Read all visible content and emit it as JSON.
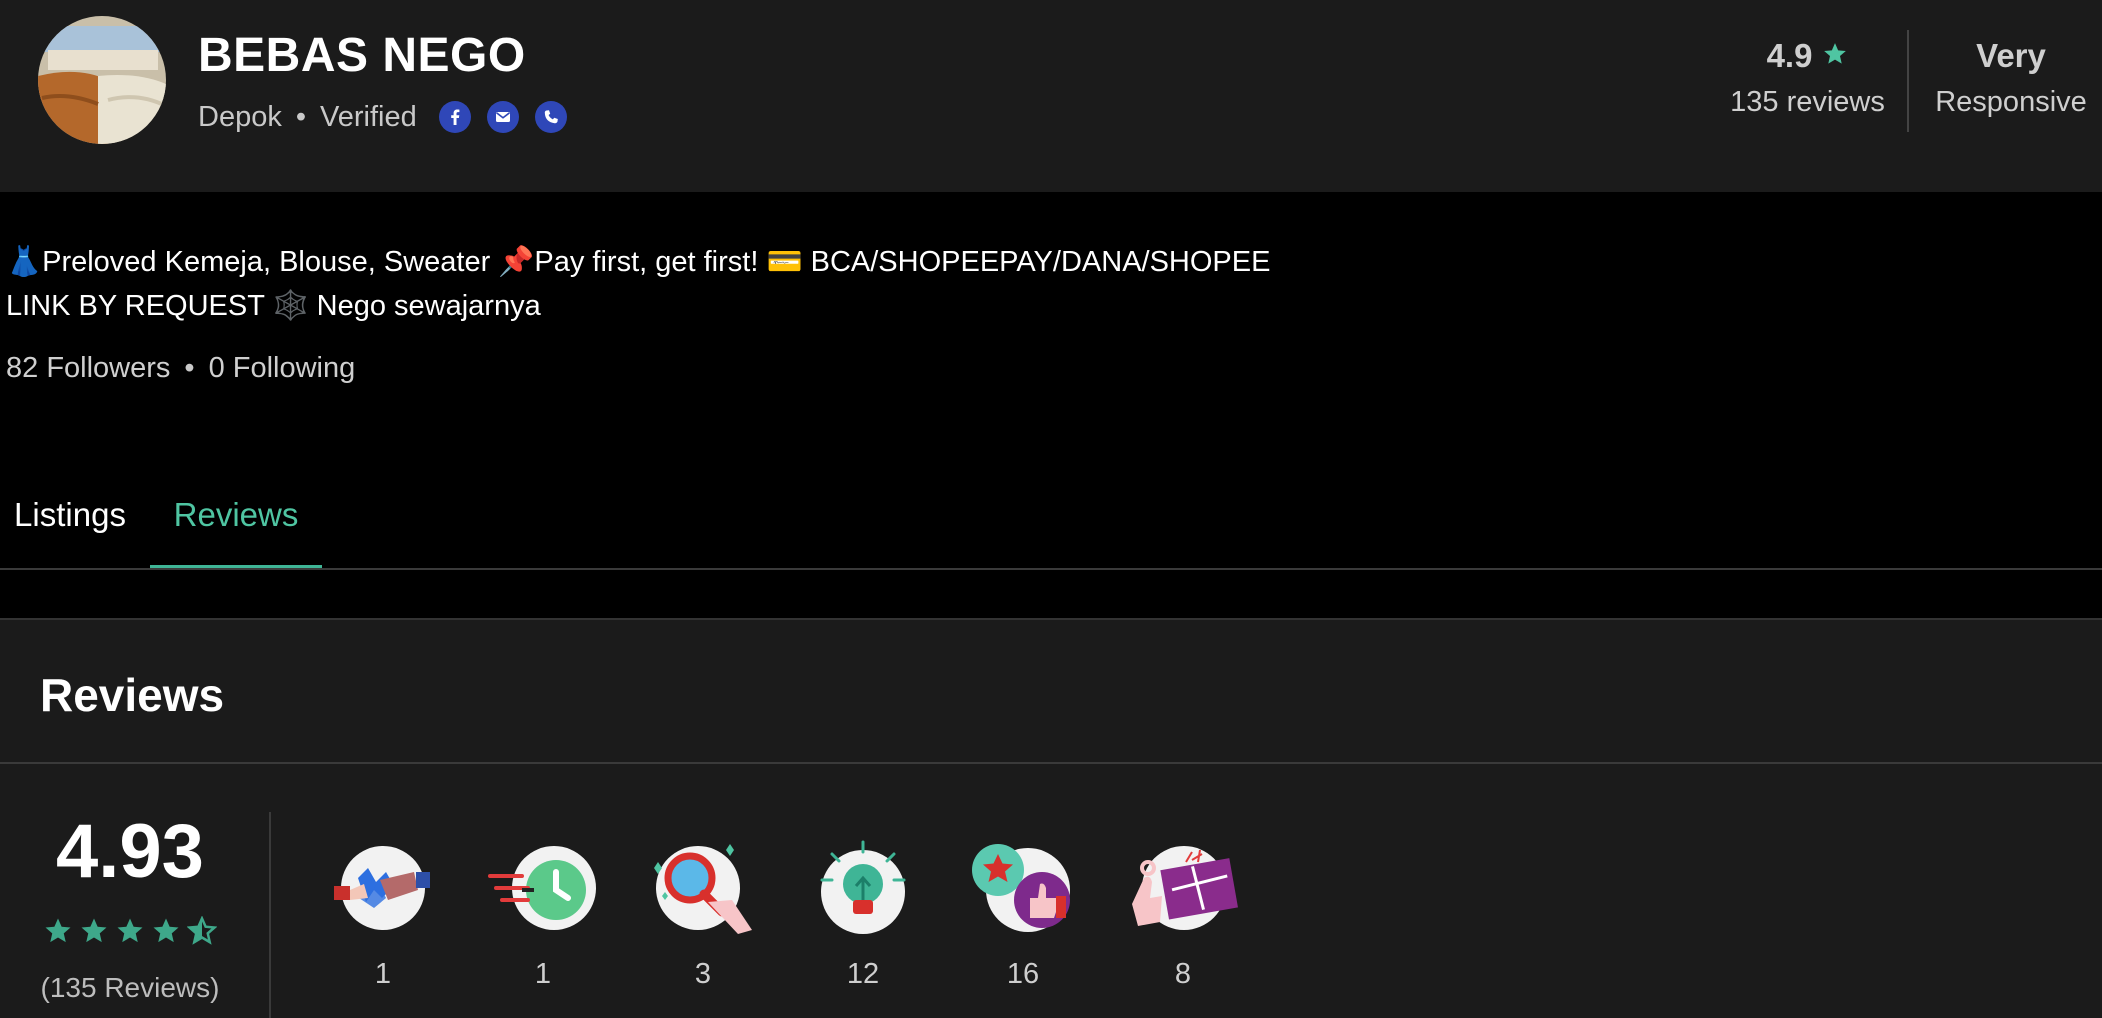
{
  "shop": {
    "name": "BEBAS NEGO",
    "location": "Depok",
    "verified_label": "Verified",
    "social_icons": [
      "facebook-icon",
      "email-icon",
      "phone-icon"
    ]
  },
  "stats": {
    "rating": "4.9",
    "reviews": "135 reviews",
    "responsiveness_line1": "Very",
    "responsiveness_line2": "Responsive"
  },
  "bio": {
    "line1": "👗Preloved Kemeja, Blouse, Sweater 📌Pay first, get first! 💳 BCA/SHOPEEPAY/DANA/SHOPEE",
    "line2": "LINK BY REQUEST 🕸️ Nego sewajarnya"
  },
  "follow": {
    "followers": "82 Followers",
    "following": "0 Following"
  },
  "tabs": [
    {
      "label": "Listings",
      "active": false
    },
    {
      "label": "Reviews",
      "active": true
    }
  ],
  "reviews": {
    "title": "Reviews",
    "score": "4.93",
    "stars": 4.5,
    "count_label": "(135 Reviews)",
    "badges": [
      {
        "icon": "handshake-icon",
        "count": "1"
      },
      {
        "icon": "fast-clock-icon",
        "count": "1"
      },
      {
        "icon": "magnifier-icon",
        "count": "3"
      },
      {
        "icon": "lightbulb-icon",
        "count": "12"
      },
      {
        "icon": "thumbs-up-star-icon",
        "count": "16"
      },
      {
        "icon": "gift-card-icon",
        "count": "8"
      }
    ]
  },
  "colors": {
    "accent": "#4fc5a2",
    "star": "#3ea88a",
    "social": "#2f47b8",
    "header_bg": "#1b1b1b"
  }
}
